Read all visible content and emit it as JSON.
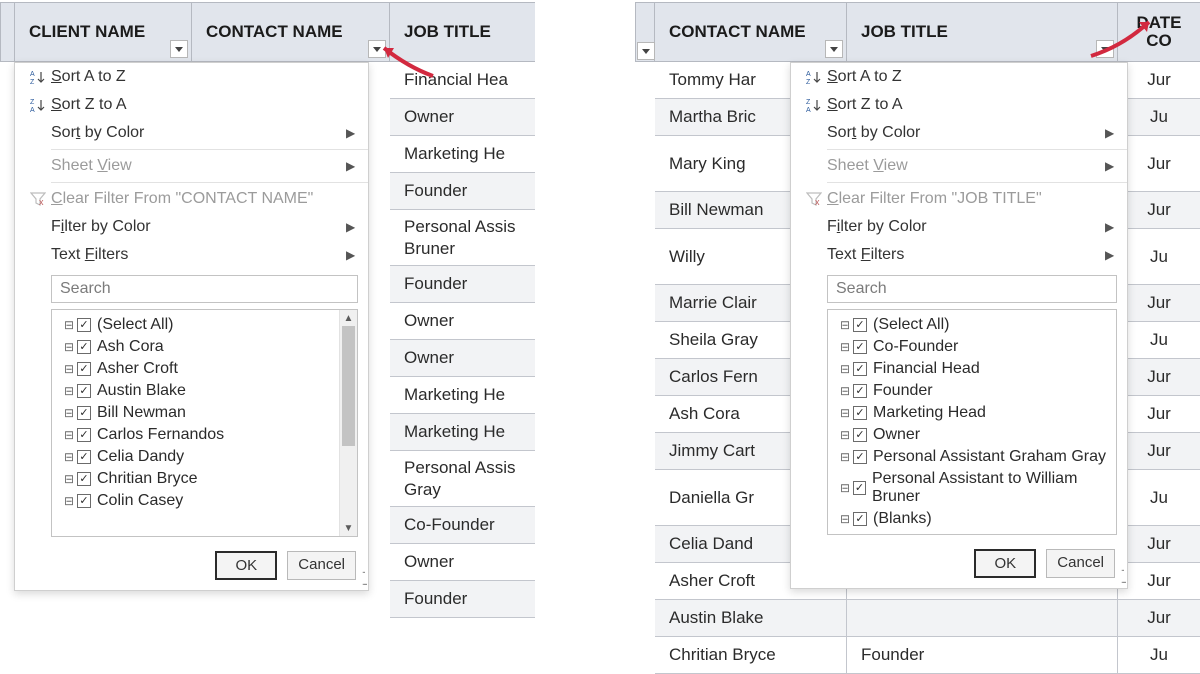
{
  "shared": {
    "sort_az": "ort A to Z",
    "sort_az_prefix": "S",
    "sort_za": "ort Z to A",
    "sort_za_prefix": "S",
    "sort_by_color": "Sor",
    "sort_by_color_u": "t",
    "sort_by_color_rest": " by Color",
    "sheet_view": "Sheet ",
    "sheet_view_u": "V",
    "sheet_view_rest": "iew",
    "clear_filter_prefix": "C",
    "clear_filter_rest_left": "lear Filter From \"CONTACT NAME\"",
    "clear_filter_rest_right": "lear Filter From \"JOB TITLE\"",
    "filter_by_color": "F",
    "filter_by_color_u": "i",
    "filter_by_color_rest": "lter by Color",
    "text_filters": "Text ",
    "text_filters_u": "F",
    "text_filters_rest": "ilters",
    "search_placeholder": "Search",
    "ok": "OK",
    "cancel": "Cancel"
  },
  "left": {
    "columns": {
      "client": "CLIENT NAME",
      "contact": "CONTACT NAME",
      "job": "JOB TITLE"
    },
    "jobs": [
      {
        "t": "Financial Hea",
        "shade": false
      },
      {
        "t": "Owner",
        "shade": true
      },
      {
        "t": "Marketing He",
        "shade": false
      },
      {
        "t": "Founder",
        "shade": true
      },
      {
        "t": "Personal Assis",
        "t2": "Bruner",
        "shade": false,
        "tall": true
      },
      {
        "t": "Founder",
        "shade": true
      },
      {
        "t": "Owner",
        "shade": false
      },
      {
        "t": "Owner",
        "shade": true
      },
      {
        "t": "Marketing He",
        "shade": false
      },
      {
        "t": "Marketing He",
        "shade": true
      },
      {
        "t": "Personal Assis",
        "t2": "Gray",
        "shade": false,
        "tall": true
      },
      {
        "t": "Co-Founder",
        "shade": true
      },
      {
        "t": "Owner",
        "shade": false
      },
      {
        "t": "Founder",
        "shade": true
      }
    ],
    "checks": [
      "(Select All)",
      "Ash Cora",
      "Asher Croft",
      "Austin Blake",
      "Bill Newman",
      "Carlos Fernandos",
      "Celia Dandy",
      "Chritian Bryce",
      "Colin Casey"
    ]
  },
  "right": {
    "columns": {
      "contact": "CONTACT NAME",
      "job": "JOB TITLE",
      "date": "DATE CO"
    },
    "rows": [
      {
        "c": "Tommy Har",
        "j": "",
        "d": "Jur",
        "shade": false
      },
      {
        "c": "Martha Bric",
        "j": "",
        "d": "Ju",
        "shade": true
      },
      {
        "c": "Mary King",
        "j": "",
        "d": "Jur",
        "shade": false,
        "tall": true
      },
      {
        "c": "Bill Newman",
        "j": "",
        "d": "Jur",
        "shade": true
      },
      {
        "c": "Willy",
        "j": "",
        "d": "Ju",
        "shade": false,
        "tall": true
      },
      {
        "c": "Marrie Clair",
        "j": "",
        "d": "Jur",
        "shade": true
      },
      {
        "c": "Sheila Gray",
        "j": "",
        "d": "Ju",
        "shade": false
      },
      {
        "c": "Carlos Fern",
        "j": "",
        "d": "Jur",
        "shade": true
      },
      {
        "c": "Ash Cora",
        "j": "",
        "d": "Jur",
        "shade": false
      },
      {
        "c": "Jimmy Cart",
        "j": "",
        "d": "Jur",
        "shade": true
      },
      {
        "c": "Daniella Gr",
        "j": "",
        "d": "Ju",
        "shade": false,
        "tall": true
      },
      {
        "c": "Celia Dand",
        "j": "",
        "d": "Jur",
        "shade": true
      },
      {
        "c": "Asher Croft",
        "j": "",
        "d": "Jur",
        "shade": false
      },
      {
        "c": "Austin Blake",
        "j": "",
        "d": "Jur",
        "shade": true
      },
      {
        "c": "Chritian Bryce",
        "j": "Founder",
        "d": "Ju",
        "shade": false
      }
    ],
    "checks": [
      "(Select All)",
      "Co-Founder",
      "Financial Head",
      "Founder",
      "Marketing Head",
      "Owner",
      "Personal Assistant Graham Gray",
      "Personal Assistant to William Bruner",
      "(Blanks)"
    ]
  }
}
